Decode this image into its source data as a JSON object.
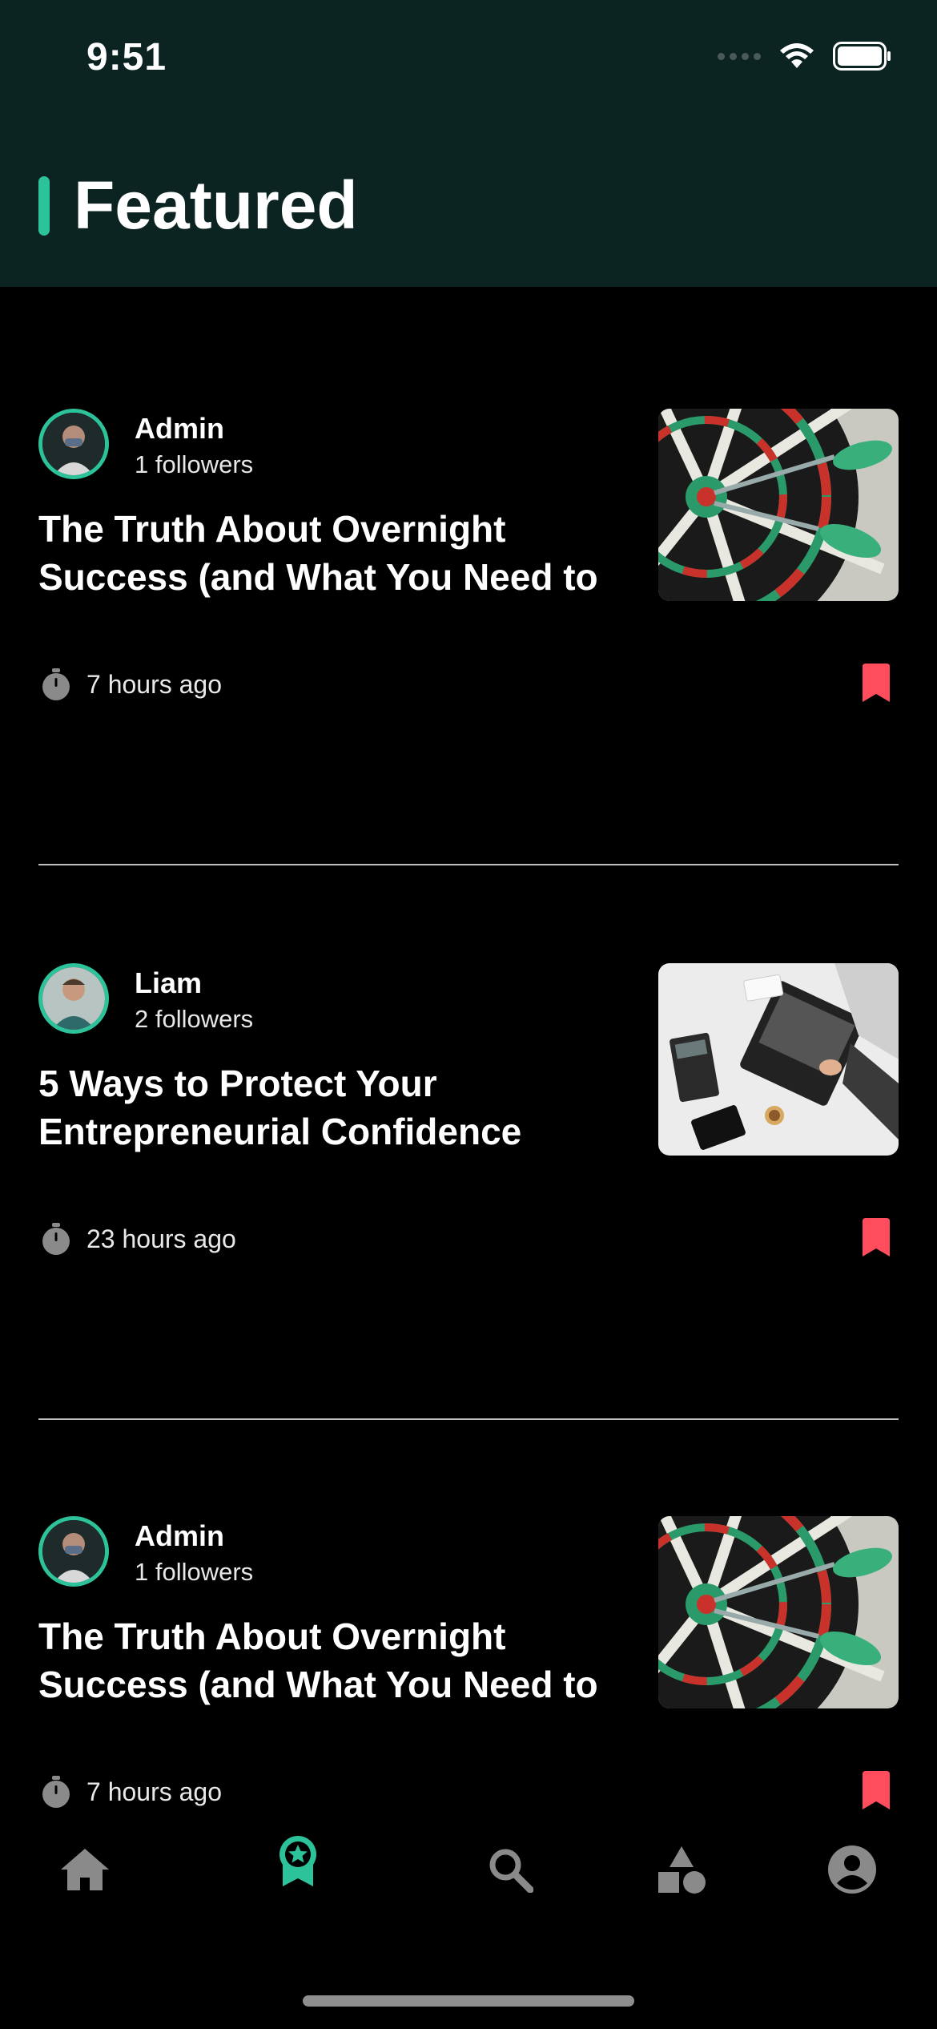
{
  "status_bar": {
    "time": "9:51"
  },
  "header": {
    "title": "Featured"
  },
  "posts": [
    {
      "author": "Admin",
      "followers": "1 followers",
      "title": "The Truth About Overnight Success (and What You Need to",
      "time": "7 hours ago"
    },
    {
      "author": "Liam",
      "followers": "2 followers",
      "title": "5 Ways to Protect Your Entrepreneurial Confidence",
      "time": "23 hours ago"
    },
    {
      "author": "Admin",
      "followers": "1 followers",
      "title": "The Truth About Overnight Success (and What You Need to",
      "time": "7 hours ago"
    }
  ],
  "tabbar": {
    "items": [
      {
        "icon": "home-icon",
        "active": false
      },
      {
        "icon": "featured-badge-icon",
        "active": true
      },
      {
        "icon": "search-icon",
        "active": false
      },
      {
        "icon": "categories-icon",
        "active": false
      },
      {
        "icon": "profile-icon",
        "active": false
      }
    ]
  },
  "colors": {
    "header_bg": "#0c2421",
    "accent": "#2cc39a",
    "bookmark": "#ff4d5e",
    "background": "#000000",
    "inactive_icon": "#8a8a8a"
  }
}
